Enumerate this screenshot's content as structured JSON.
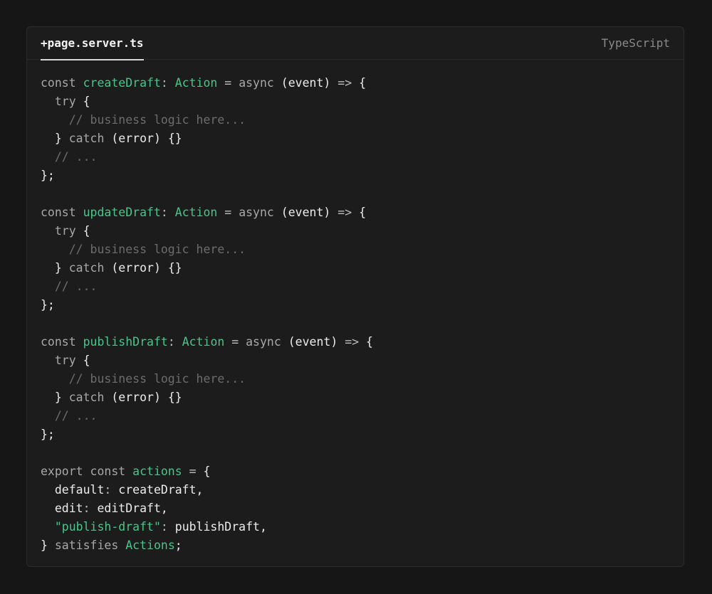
{
  "header": {
    "file_name": "+page.server.ts",
    "language": "TypeScript"
  },
  "colors": {
    "background": "#161616",
    "card": "#1c1c1c",
    "accent_green": "#4cc38a",
    "comment": "#6c6c6c",
    "keyword": "#a8a8a8",
    "plain": "#ececec"
  },
  "code": {
    "lines": [
      [
        {
          "t": "kw",
          "v": "const "
        },
        {
          "t": "name",
          "v": "createDraft"
        },
        {
          "t": "punct",
          "v": ": "
        },
        {
          "t": "type",
          "v": "Action"
        },
        {
          "t": "punct",
          "v": " = "
        },
        {
          "t": "kw",
          "v": "async "
        },
        {
          "t": "plain",
          "v": "(event) "
        },
        {
          "t": "punct",
          "v": "=> "
        },
        {
          "t": "plain",
          "v": "{"
        }
      ],
      [
        {
          "t": "kw",
          "v": "  try "
        },
        {
          "t": "plain",
          "v": "{"
        }
      ],
      [
        {
          "t": "comment",
          "v": "    // business logic here..."
        }
      ],
      [
        {
          "t": "plain",
          "v": "  } "
        },
        {
          "t": "kw",
          "v": "catch "
        },
        {
          "t": "plain",
          "v": "(error) {}"
        }
      ],
      [
        {
          "t": "comment",
          "v": "  // ..."
        }
      ],
      [
        {
          "t": "plain",
          "v": "};"
        }
      ],
      [],
      [
        {
          "t": "kw",
          "v": "const "
        },
        {
          "t": "name",
          "v": "updateDraft"
        },
        {
          "t": "punct",
          "v": ": "
        },
        {
          "t": "type",
          "v": "Action"
        },
        {
          "t": "punct",
          "v": " = "
        },
        {
          "t": "kw",
          "v": "async "
        },
        {
          "t": "plain",
          "v": "(event) "
        },
        {
          "t": "punct",
          "v": "=> "
        },
        {
          "t": "plain",
          "v": "{"
        }
      ],
      [
        {
          "t": "kw",
          "v": "  try "
        },
        {
          "t": "plain",
          "v": "{"
        }
      ],
      [
        {
          "t": "comment",
          "v": "    // business logic here..."
        }
      ],
      [
        {
          "t": "plain",
          "v": "  } "
        },
        {
          "t": "kw",
          "v": "catch "
        },
        {
          "t": "plain",
          "v": "(error) {}"
        }
      ],
      [
        {
          "t": "comment",
          "v": "  // ..."
        }
      ],
      [
        {
          "t": "plain",
          "v": "};"
        }
      ],
      [],
      [
        {
          "t": "kw",
          "v": "const "
        },
        {
          "t": "name",
          "v": "publishDraft"
        },
        {
          "t": "punct",
          "v": ": "
        },
        {
          "t": "type",
          "v": "Action"
        },
        {
          "t": "punct",
          "v": " = "
        },
        {
          "t": "kw",
          "v": "async "
        },
        {
          "t": "plain",
          "v": "(event) "
        },
        {
          "t": "punct",
          "v": "=> "
        },
        {
          "t": "plain",
          "v": "{"
        }
      ],
      [
        {
          "t": "kw",
          "v": "  try "
        },
        {
          "t": "plain",
          "v": "{"
        }
      ],
      [
        {
          "t": "comment",
          "v": "    // business logic here..."
        }
      ],
      [
        {
          "t": "plain",
          "v": "  } "
        },
        {
          "t": "kw",
          "v": "catch "
        },
        {
          "t": "plain",
          "v": "(error) {}"
        }
      ],
      [
        {
          "t": "comment",
          "v": "  // ..."
        }
      ],
      [
        {
          "t": "plain",
          "v": "};"
        }
      ],
      [],
      [
        {
          "t": "kw",
          "v": "export const "
        },
        {
          "t": "name",
          "v": "actions"
        },
        {
          "t": "punct",
          "v": " = "
        },
        {
          "t": "plain",
          "v": "{"
        }
      ],
      [
        {
          "t": "plain",
          "v": "  default"
        },
        {
          "t": "punct",
          "v": ": "
        },
        {
          "t": "plain",
          "v": "createDraft,"
        }
      ],
      [
        {
          "t": "plain",
          "v": "  edit"
        },
        {
          "t": "punct",
          "v": ": "
        },
        {
          "t": "plain",
          "v": "editDraft,"
        }
      ],
      [
        {
          "t": "plain",
          "v": "  "
        },
        {
          "t": "string",
          "v": "\"publish-draft\""
        },
        {
          "t": "punct",
          "v": ": "
        },
        {
          "t": "plain",
          "v": "publishDraft,"
        }
      ],
      [
        {
          "t": "plain",
          "v": "} "
        },
        {
          "t": "kw",
          "v": "satisfies "
        },
        {
          "t": "type",
          "v": "Actions"
        },
        {
          "t": "plain",
          "v": ";"
        }
      ]
    ]
  }
}
